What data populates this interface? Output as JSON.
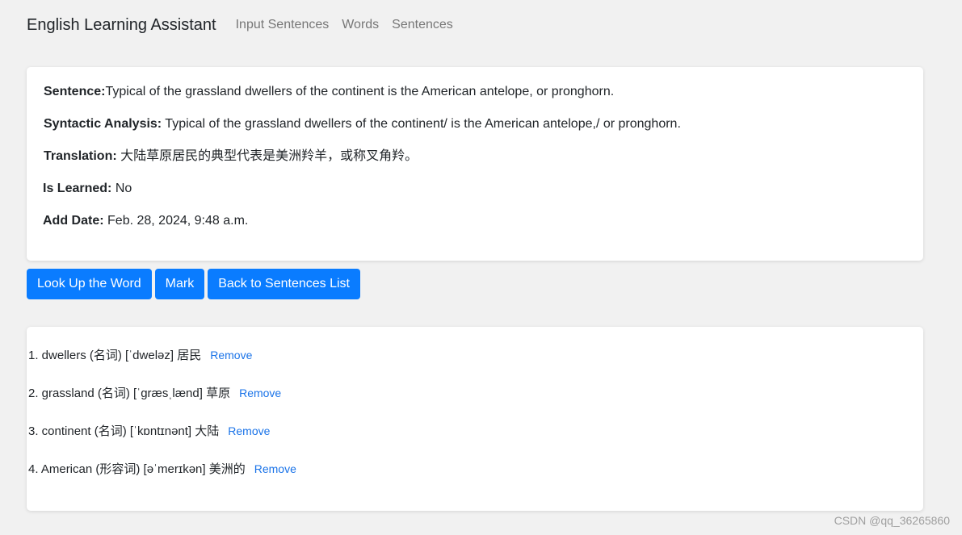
{
  "navbar": {
    "brand": "English Learning Assistant",
    "links": [
      "Input Sentences",
      "Words",
      "Sentences"
    ]
  },
  "detail": {
    "sentence_label": "Sentence:",
    "sentence_value": "Typical of the grassland dwellers of the continent is the American antelope, or pronghorn.",
    "analysis_label": "Syntactic Analysis:",
    "analysis_value": "Typical of the grassland dwellers of the continent/ is the American antelope,/ or pronghorn.",
    "translation_label": "Translation:",
    "translation_value": "大陆草原居民的典型代表是美洲羚羊，或称叉角羚。",
    "learned_label": "Is Learned:",
    "learned_value": "No",
    "date_label": "Add Date:",
    "date_value": "Feb. 28, 2024, 9:48 a.m."
  },
  "buttons": {
    "lookup": "Look Up the Word",
    "mark": "Mark",
    "back": "Back to Sentences List"
  },
  "words": [
    {
      "text": "1. dwellers (名词) [ˈdweləz] 居民",
      "action": "Remove"
    },
    {
      "text": "2. grassland (名词) [ˈɡræsˌlænd] 草原",
      "action": "Remove"
    },
    {
      "text": "3. continent (名词) [ˈkɒntɪnənt] 大陆",
      "action": "Remove"
    },
    {
      "text": "4. American (形容词) [əˈmerɪkən] 美洲的",
      "action": "Remove"
    }
  ],
  "watermark": "CSDN @qq_36265860"
}
